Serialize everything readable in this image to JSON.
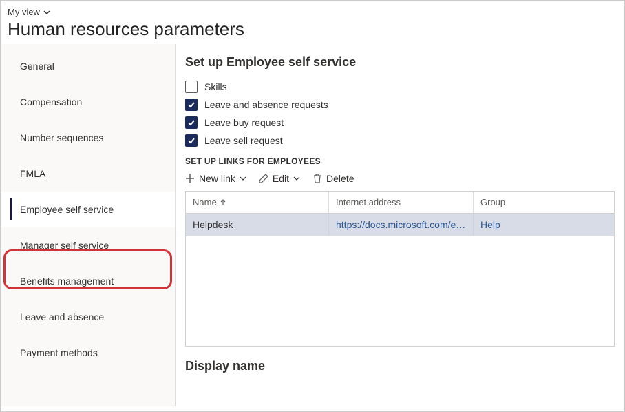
{
  "header": {
    "view_label": "My view",
    "page_title": "Human resources parameters"
  },
  "sidebar": {
    "items": [
      {
        "label": "General",
        "selected": false
      },
      {
        "label": "Compensation",
        "selected": false
      },
      {
        "label": "Number sequences",
        "selected": false
      },
      {
        "label": "FMLA",
        "selected": false
      },
      {
        "label": "Employee self service",
        "selected": true
      },
      {
        "label": "Manager self service",
        "selected": false
      },
      {
        "label": "Benefits management",
        "selected": false
      },
      {
        "label": "Leave and absence",
        "selected": false
      },
      {
        "label": "Payment methods",
        "selected": false
      }
    ]
  },
  "main": {
    "section_title": "Set up Employee self service",
    "checkboxes": [
      {
        "label": "Skills",
        "checked": false
      },
      {
        "label": "Leave and absence requests",
        "checked": true
      },
      {
        "label": "Leave buy request",
        "checked": true
      },
      {
        "label": "Leave sell request",
        "checked": true
      }
    ],
    "links_header": "SET UP LINKS FOR EMPLOYEES",
    "toolbar": {
      "new_link_label": "New link",
      "edit_label": "Edit",
      "delete_label": "Delete"
    },
    "table": {
      "columns": {
        "name": "Name",
        "internet_address": "Internet address",
        "group": "Group"
      },
      "rows": [
        {
          "name": "Helpdesk",
          "internet_address": "https://docs.microsoft.com/en-u...",
          "group": "Help"
        }
      ]
    },
    "display_name_title": "Display name"
  }
}
